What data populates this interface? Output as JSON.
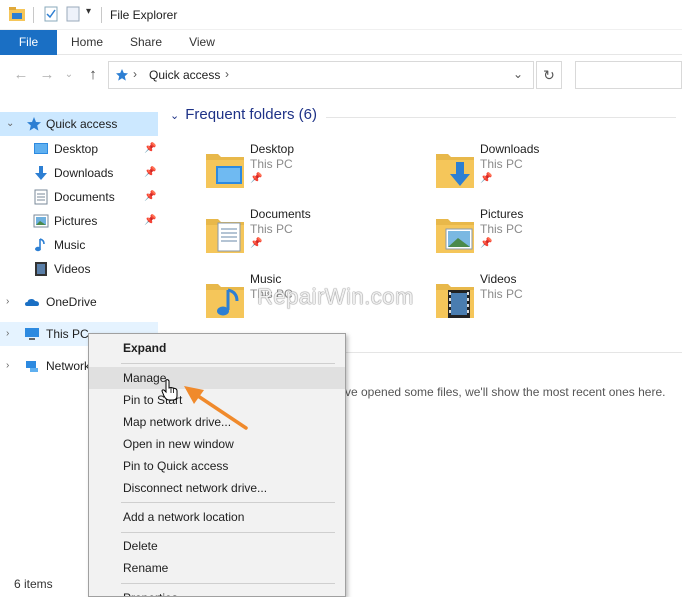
{
  "window": {
    "title": "File Explorer"
  },
  "ribbon": {
    "tabs": [
      "File",
      "Home",
      "Share",
      "View"
    ]
  },
  "address": {
    "crumb": "Quick access"
  },
  "nav": {
    "quick_access": "Quick access",
    "items": [
      {
        "label": "Desktop",
        "pinned": true
      },
      {
        "label": "Downloads",
        "pinned": true
      },
      {
        "label": "Documents",
        "pinned": true
      },
      {
        "label": "Pictures",
        "pinned": true
      },
      {
        "label": "Music",
        "pinned": false
      },
      {
        "label": "Videos",
        "pinned": false
      }
    ],
    "onedrive": "OneDrive",
    "this_pc": "This PC",
    "network": "Network"
  },
  "content": {
    "group_title": "Frequent folders (6)",
    "folders": [
      {
        "name": "Desktop",
        "location": "This PC"
      },
      {
        "name": "Downloads",
        "location": "This PC"
      },
      {
        "name": "Documents",
        "location": "This PC"
      },
      {
        "name": "Pictures",
        "location": "This PC"
      },
      {
        "name": "Music",
        "location": "This PC"
      },
      {
        "name": "Videos",
        "location": "This PC"
      }
    ],
    "recent_text": "ve opened some files, we'll show the most recent ones here."
  },
  "watermark": "RepairWin.com",
  "status": {
    "items": "6 items"
  },
  "context_menu": {
    "expand": "Expand",
    "manage": "Manage",
    "pin_start": "Pin to Start",
    "map_drive": "Map network drive...",
    "open_new": "Open in new window",
    "pin_quick": "Pin to Quick access",
    "disconnect": "Disconnect network drive...",
    "add_location": "Add a network location",
    "delete": "Delete",
    "rename": "Rename",
    "properties": "Properties"
  },
  "colors": {
    "accent": "#1a6fc4",
    "selected": "#cce8ff",
    "arrow": "#f08a2c",
    "folder": "#f5c65a"
  }
}
